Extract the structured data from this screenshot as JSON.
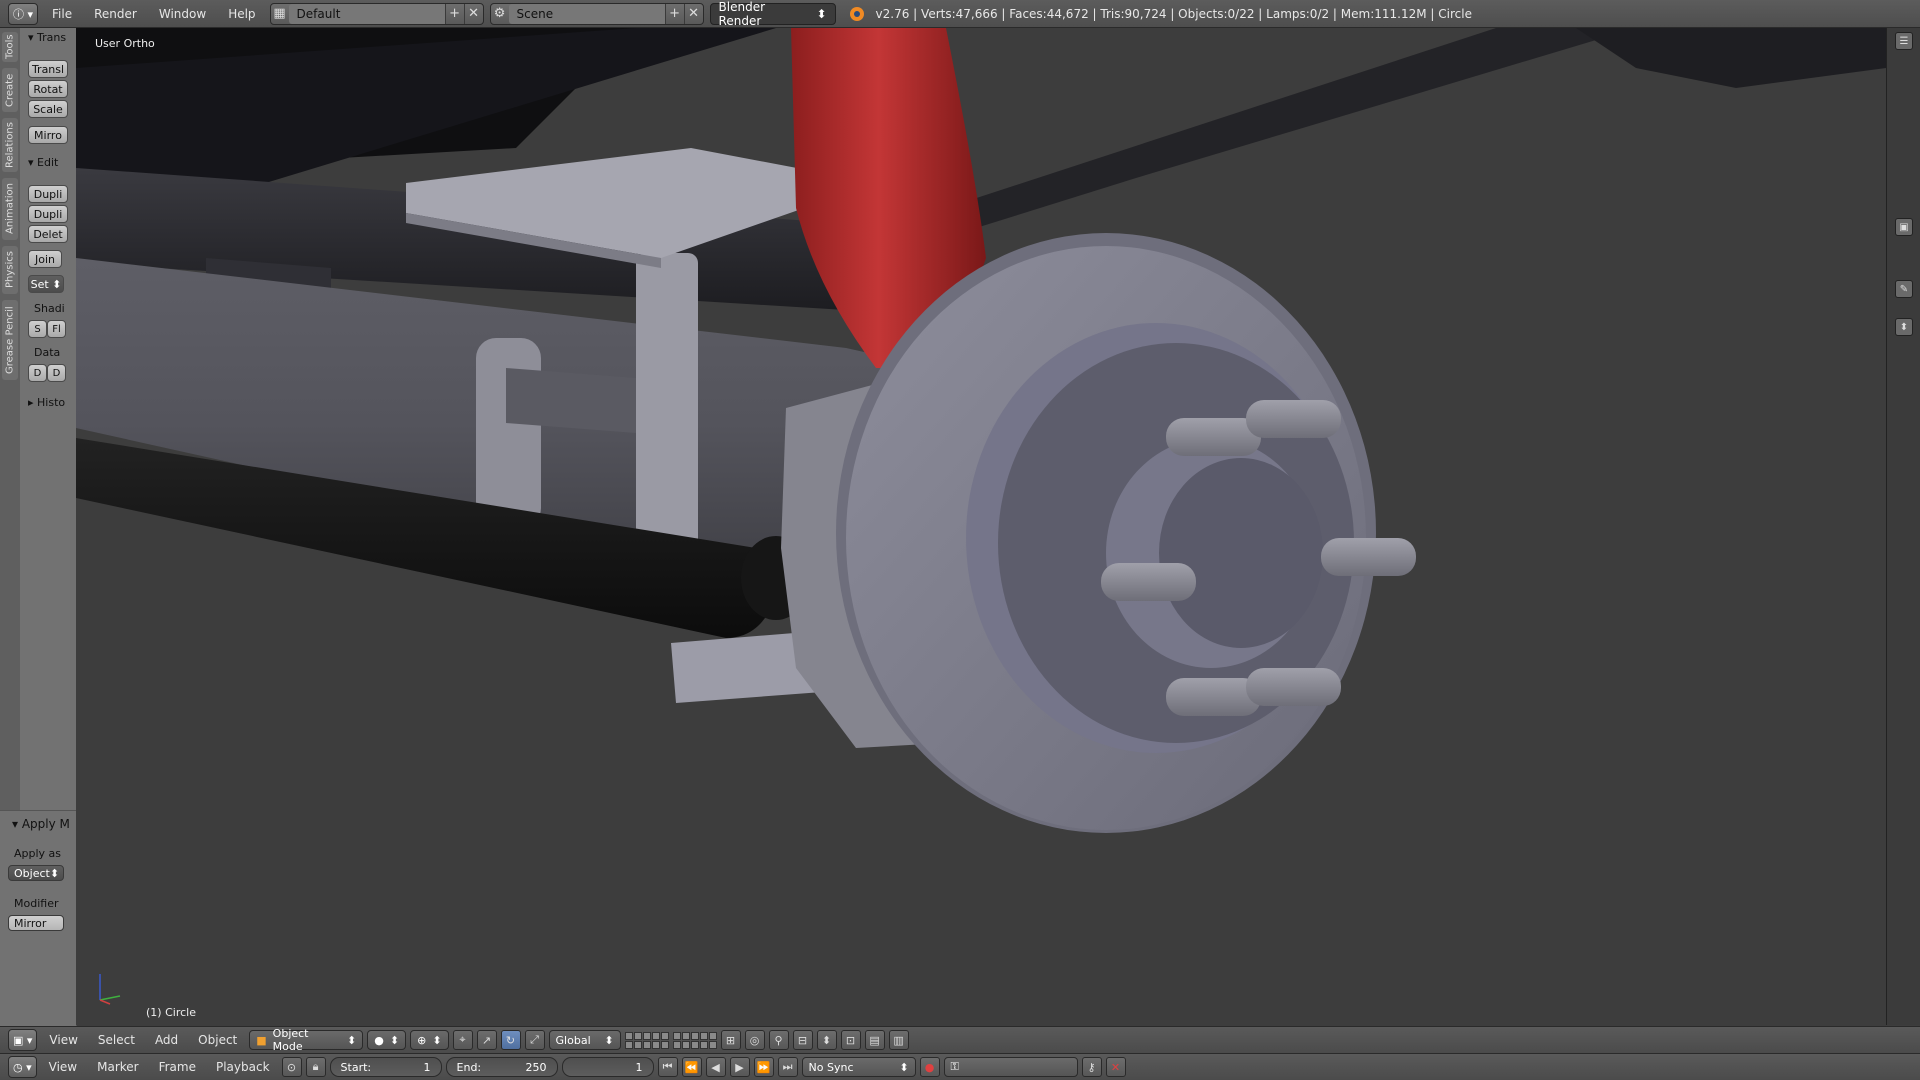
{
  "topbar": {
    "menus": [
      "File",
      "Render",
      "Window",
      "Help"
    ],
    "screen_layout": "Default",
    "scene": "Scene",
    "render_engine": "Blender Render",
    "stats": "v2.76 | Verts:47,666 | Faces:44,672 | Tris:90,724 | Objects:0/22 | Lamps:0/2 | Mem:111.12M | Circle"
  },
  "tabs": [
    "Tools",
    "Create",
    "Relations",
    "Animation",
    "Physics",
    "Grease Pencil"
  ],
  "toolshelf": {
    "transform_header": "Trans",
    "transform_buttons": [
      "Transl",
      "Rotat",
      "Scale"
    ],
    "mirror_button": "Mirro",
    "edit_header": "Edit",
    "edit_buttons": [
      "Dupli",
      "Dupli",
      "Delet"
    ],
    "join_button": "Join",
    "set_origin": "Set",
    "shading_label": "Shadi",
    "shading_smooth": "S",
    "shading_flat": "Fl",
    "data_label": "Data",
    "data_btn1": "D",
    "data_btn2": "D",
    "history_header": "Histo"
  },
  "operator": {
    "title": "Apply M",
    "apply_as_label": "Apply as",
    "apply_as_value": "Object",
    "modifier_label": "Modifier",
    "modifier_value": "Mirror"
  },
  "viewport": {
    "view_name": "User Ortho",
    "object_info": "(1) Circle"
  },
  "view3d_header": {
    "menus": [
      "View",
      "Select",
      "Add",
      "Object"
    ],
    "mode": "Object Mode",
    "orientation": "Global"
  },
  "timeline": {
    "menus": [
      "View",
      "Marker",
      "Frame",
      "Playback"
    ],
    "start_label": "Start:",
    "start_value": "1",
    "end_label": "End:",
    "end_value": "250",
    "current_frame": "1",
    "sync": "No Sync"
  },
  "colors": {
    "viewport_bg": "#3d3d3d",
    "shock_red": "#b02a2a",
    "hub_grey": "#7a7a88",
    "selected_outline": "#f08a24"
  },
  "icons": [
    "info-editor-icon",
    "screen-layout-icon",
    "scene-icon",
    "blender-logo-icon",
    "view3d-editor-icon",
    "timeline-editor-icon",
    "record-icon",
    "keying-icon"
  ]
}
